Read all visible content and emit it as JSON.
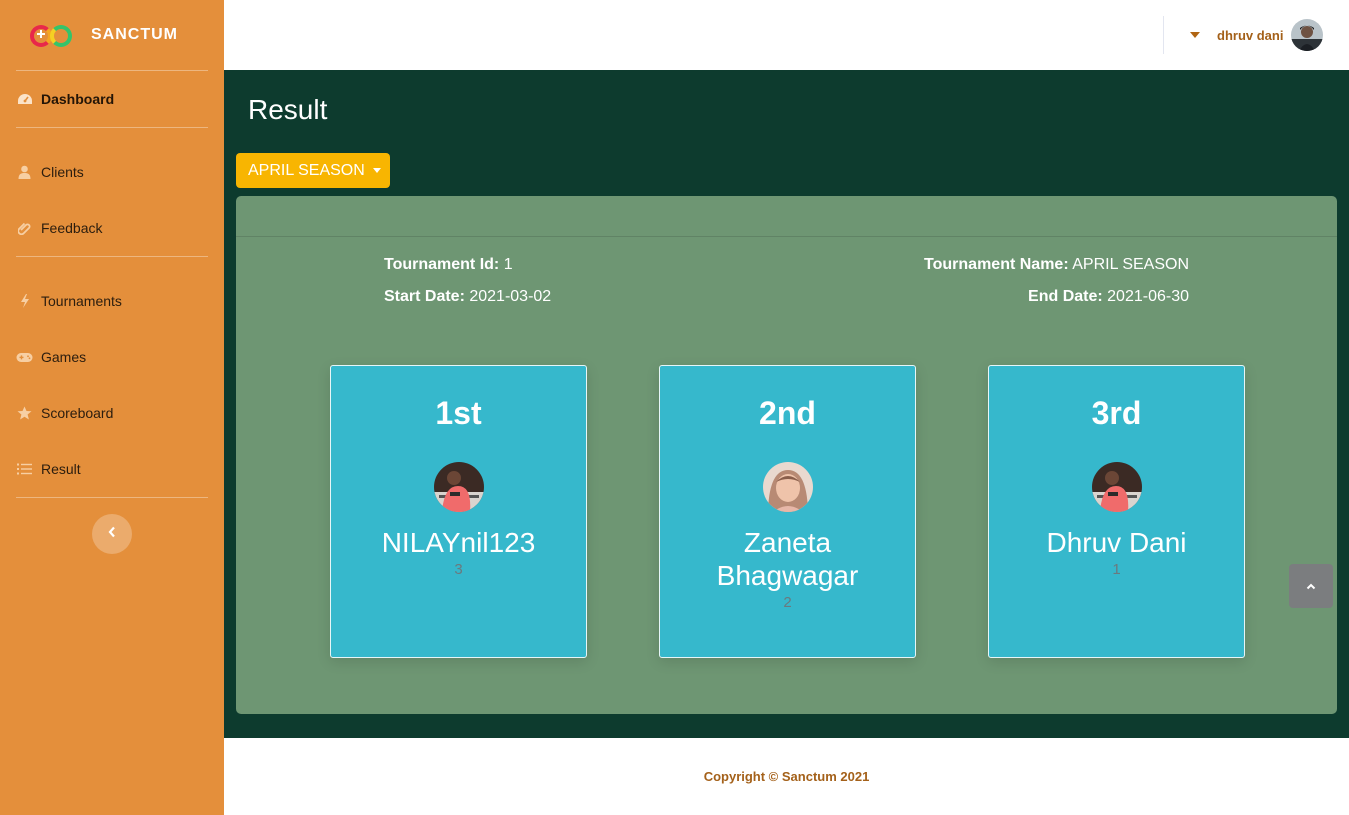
{
  "brand": {
    "name": "SANCTUM",
    "logo_icon": "sanctum-logo-icon"
  },
  "sidebar": {
    "items": [
      {
        "label": "Dashboard",
        "icon": "tachometer-icon",
        "active": true
      },
      {
        "label": "Clients",
        "icon": "user-icon"
      },
      {
        "label": "Feedback",
        "icon": "paperclip-icon"
      },
      {
        "label": "Tournaments",
        "icon": "bolt-icon"
      },
      {
        "label": "Games",
        "icon": "gamepad-icon"
      },
      {
        "label": "Scoreboard",
        "icon": "star-icon"
      },
      {
        "label": "Result",
        "icon": "list-icon"
      }
    ],
    "collapse_icon": "chevron-left-icon"
  },
  "topbar": {
    "username": "dhruv dani",
    "caret_icon": "caret-down-icon"
  },
  "page": {
    "title": "Result",
    "season_button": "APRIL SEASON",
    "tournament": {
      "id_label": "Tournament Id:",
      "id_value": "1",
      "name_label": "Tournament Name:",
      "name_value": "APRIL SEASON",
      "start_label": "Start Date:",
      "start_value": "2021-03-02",
      "end_label": "End Date:",
      "end_value": "2021-06-30"
    },
    "winners": [
      {
        "rank": "1st",
        "name": "NILAYnil123",
        "score": "3"
      },
      {
        "rank": "2nd",
        "name": "Zaneta Bhagwagar",
        "score": "2"
      },
      {
        "rank": "3rd",
        "name": "Dhruv Dani",
        "score": "1"
      }
    ]
  },
  "footer": {
    "copyright": "Copyright © Sanctum 2021"
  },
  "colors": {
    "sidebar": "#e48f3b",
    "main_bg": "#0d3b2e",
    "panel": "#6e9673",
    "card": "#36b8cc",
    "button": "#f8b501",
    "accent_text": "#a4611a"
  }
}
